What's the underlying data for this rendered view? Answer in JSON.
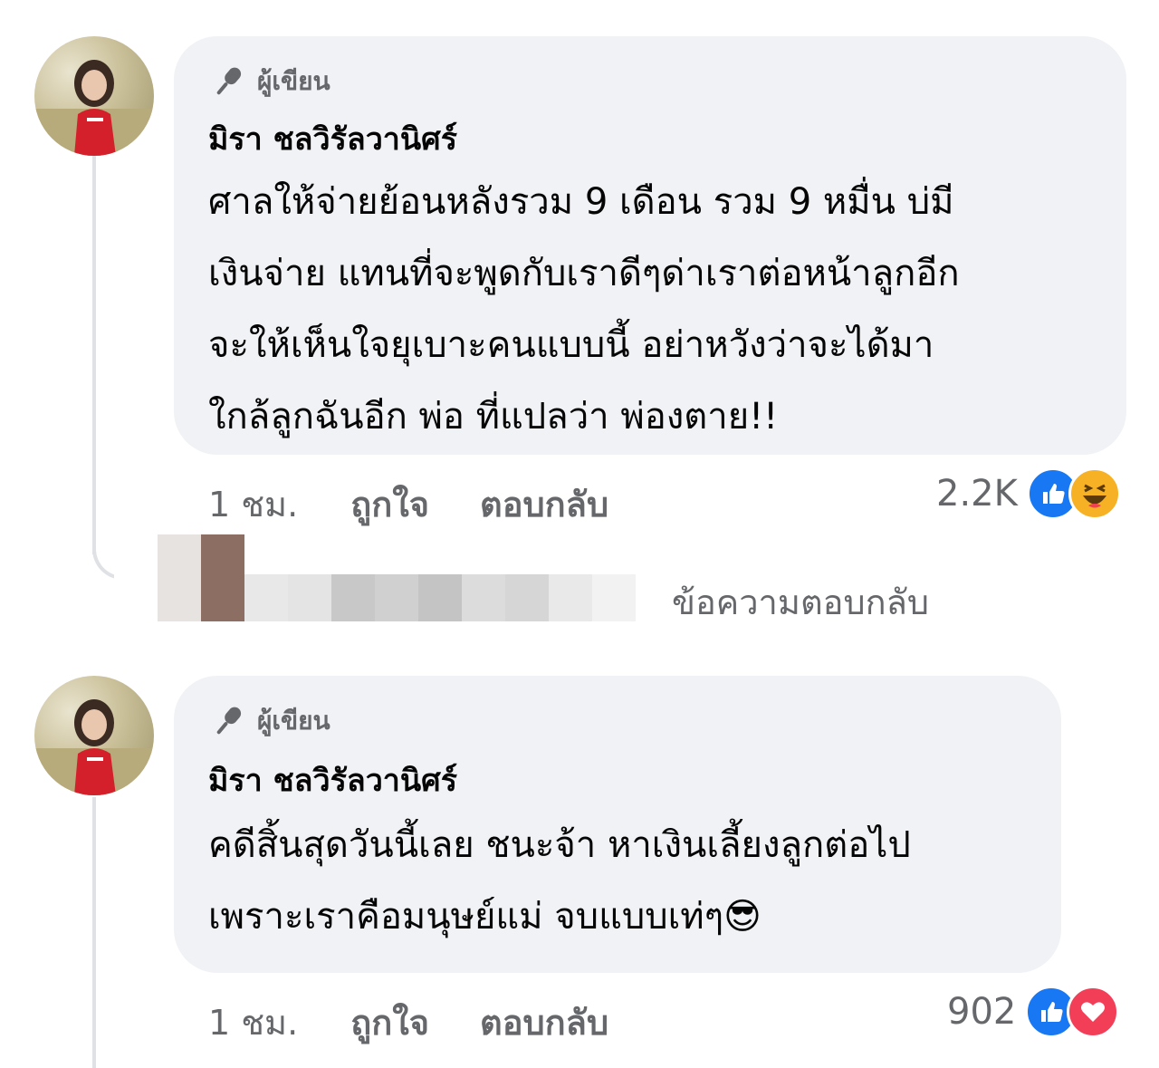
{
  "colors": {
    "bubble": "#f0f2f5",
    "meta": "#65676b",
    "like_blue": "#1877f2",
    "love_red": "#f33e58",
    "haha_yellow": "#f7b125"
  },
  "comments": [
    {
      "author_badge": "ผู้เขียน",
      "author_badge_icon": "microphone-icon",
      "name": "มิรา ชลวิรัลวานิศร์",
      "lines": [
        "ศาลให้จ่ายย้อนหลังรวม 9 เดือน รวม 9 หมื่น บ่มี",
        "เงินจ่าย แทนที่จะพูดกับเราดีๆด่าเราต่อหน้าลูกอีก",
        "จะให้เห็นใจยุเบาะคนแบบนี้ อย่าหวังว่าจะได้มา",
        "ใกล้ลูกฉันอีก พ่อ ที่แปลว่า พ่องตาย!!"
      ],
      "time": "1 ชม.",
      "like_label": "ถูกใจ",
      "reply_label": "ตอบกลับ",
      "reaction_count": "2.2K",
      "reactions": [
        "like-icon",
        "haha-icon"
      ]
    },
    {
      "author_badge": "ผู้เขียน",
      "author_badge_icon": "microphone-icon",
      "name": "มิรา ชลวิรัลวานิศร์",
      "lines": [
        "คดีสิ้นสุดวันนี้เลย ชนะจ้า หาเงินเลี้ยงลูกต่อไป",
        "เพราะเราคือมนุษย์แม่ จบแบบเท่ๆ😎"
      ],
      "time": "1 ชม.",
      "like_label": "ถูกใจ",
      "reply_label": "ตอบกลับ",
      "reaction_count": "902",
      "reactions": [
        "like-icon",
        "love-icon"
      ]
    }
  ],
  "reply_preview": {
    "label": "ข้อความตอบกลับ"
  }
}
